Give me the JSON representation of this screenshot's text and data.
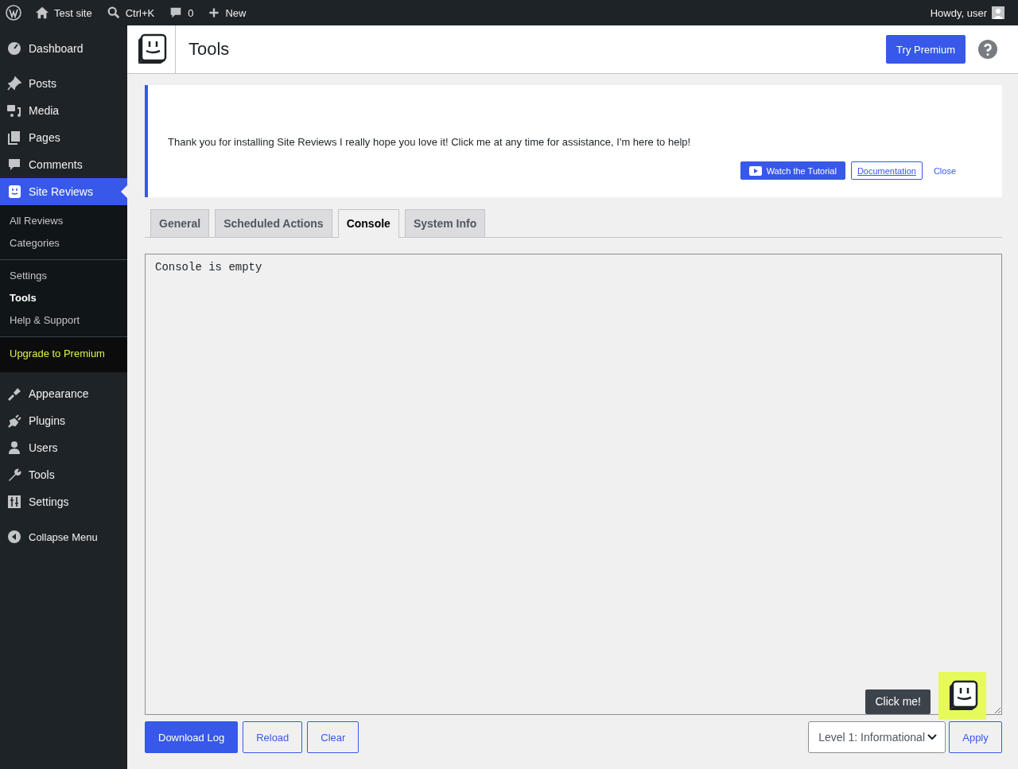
{
  "admin_bar": {
    "site": "Test site",
    "search": "Ctrl+K",
    "comments": "0",
    "new": "New",
    "greeting": "Howdy, user"
  },
  "sidebar": {
    "items": [
      {
        "label": "Dashboard",
        "selected": false
      },
      {
        "label": "Posts",
        "selected": false
      },
      {
        "label": "Media",
        "selected": false
      },
      {
        "label": "Pages",
        "selected": false
      },
      {
        "label": "Comments",
        "selected": false
      },
      {
        "label": "Site Reviews",
        "selected": true,
        "submenu": [
          [
            {
              "label": "All Reviews",
              "selected": false
            },
            {
              "label": "Categories",
              "selected": false
            }
          ],
          [
            {
              "label": "Settings",
              "selected": false
            },
            {
              "label": "Tools",
              "selected": true
            },
            {
              "label": "Help & Support",
              "selected": false
            }
          ],
          [
            {
              "label": "Upgrade to Premium",
              "selected": false,
              "kind": "upgrade"
            }
          ]
        ]
      },
      {
        "label": "Appearance",
        "selected": false
      },
      {
        "label": "Plugins",
        "selected": false
      },
      {
        "label": "Users",
        "selected": false
      },
      {
        "label": "Tools",
        "selected": false
      },
      {
        "label": "Settings",
        "selected": false
      },
      {
        "label": "Collapse Menu",
        "selected": false
      }
    ]
  },
  "header": {
    "title": "Tools",
    "premium_button": "Try Premium"
  },
  "notice": {
    "message": "Thank you for installing Site Reviews I really hope you love it! Click me at any time for assistance, I'm here to help!",
    "tutorial_button": "Watch the Tutorial",
    "docs_button": "Documentation",
    "close": "Close"
  },
  "tabs": [
    {
      "label": "General",
      "selected": false
    },
    {
      "label": "Scheduled Actions",
      "selected": false
    },
    {
      "label": "Console",
      "selected": true
    },
    {
      "label": "System Info",
      "selected": false
    }
  ],
  "console": {
    "value": "Console is empty"
  },
  "buttons": [
    "Download Log",
    "Reload",
    "Clear"
  ],
  "level_select": {
    "value": "Level 1: Informational"
  },
  "apply_button": "Apply",
  "tooltip": "Click me!"
}
